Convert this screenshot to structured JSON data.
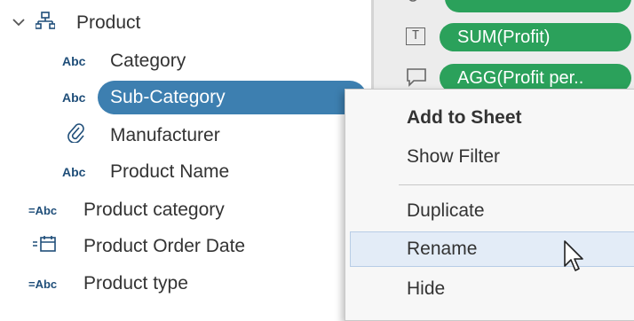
{
  "data_pane": {
    "group": {
      "name": "Product",
      "chevron": "chevron-down-icon",
      "icon": "hierarchy-icon"
    },
    "fields": [
      {
        "label": "Category",
        "icon_text": "Abc",
        "icon": "string-field-icon"
      },
      {
        "label": "Sub-Category",
        "icon_text": "Abc",
        "icon": "string-field-icon",
        "selected": true
      },
      {
        "label": "Manufacturer",
        "icon_text": "",
        "icon": "paperclip-icon"
      },
      {
        "label": "Product Name",
        "icon_text": "Abc",
        "icon": "string-field-icon"
      },
      {
        "label": "Product category",
        "icon_text": "=Abc",
        "icon": "calculated-string-icon"
      },
      {
        "label": "Product Order Date",
        "icon_text": "",
        "icon": "calculated-date-icon"
      },
      {
        "label": "Product type",
        "icon_text": "=Abc",
        "icon": "calculated-string-icon"
      }
    ]
  },
  "marks": {
    "pills": [
      {
        "label": "SUM(Profit)",
        "icon": "text-mark-icon",
        "icon_text": "T"
      },
      {
        "label": "AGG(Profit per..",
        "icon": "tooltip-mark-icon"
      }
    ],
    "accent_color": "#2ba15b"
  },
  "context_menu": {
    "items": [
      {
        "label": "Add to Sheet",
        "bold": true
      },
      {
        "label": "Show Filter"
      },
      {
        "label": "Duplicate"
      },
      {
        "label": "Rename",
        "hover": true
      },
      {
        "label": "Hide"
      }
    ]
  },
  "colors": {
    "selection": "#3d7fb0",
    "menu_hover": "#e3ecf7"
  }
}
